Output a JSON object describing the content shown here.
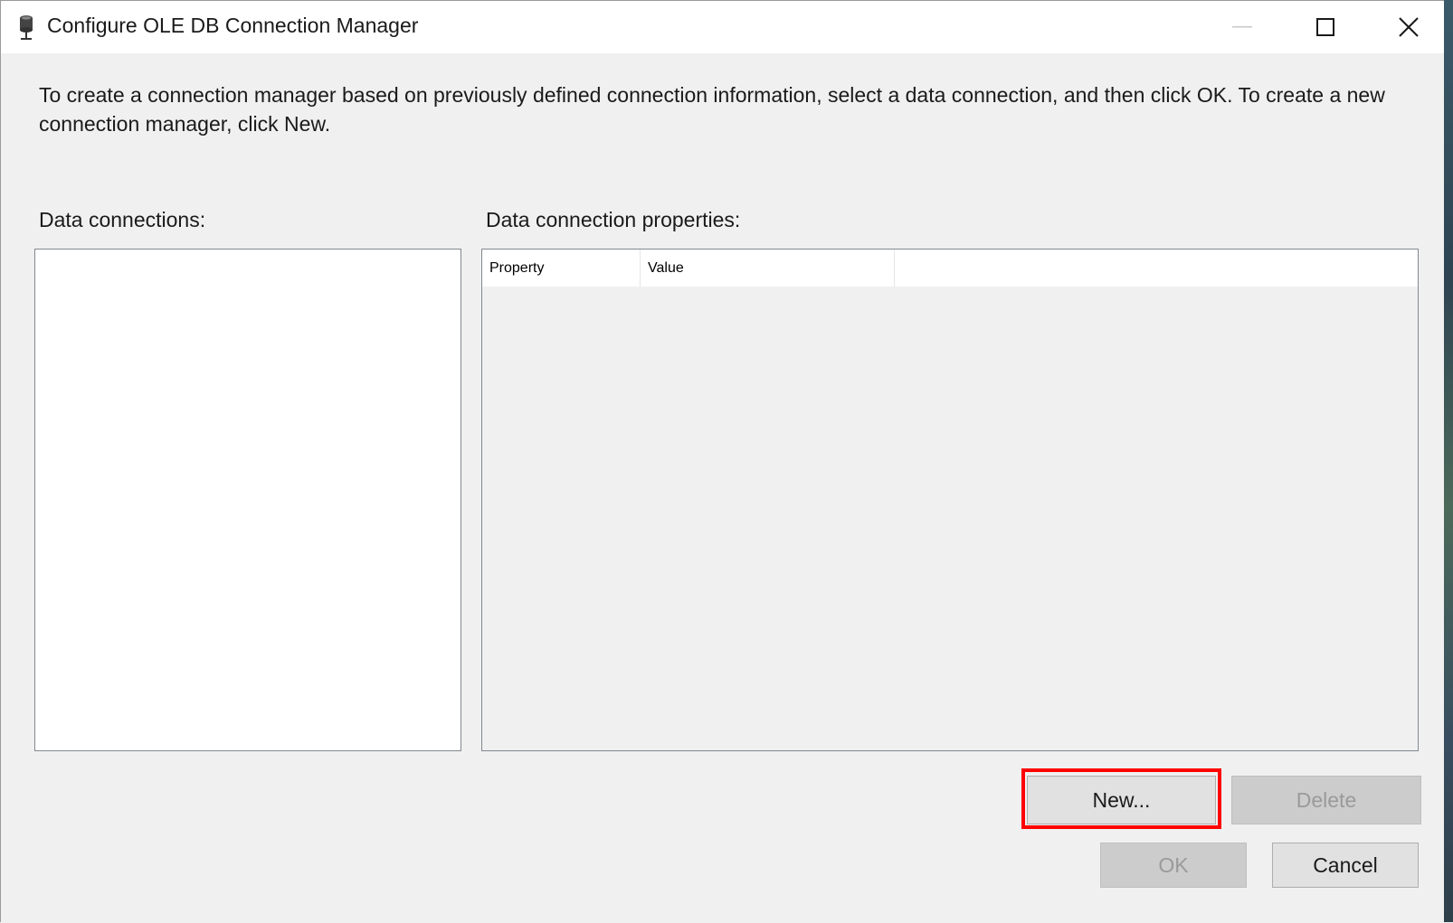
{
  "window": {
    "title": "Configure OLE DB Connection Manager",
    "controls": {
      "minimize_icon": "minimize-icon",
      "maximize_icon": "maximize-icon",
      "close_icon": "close-icon"
    },
    "app_icon": "database-connection-icon"
  },
  "instructions": "To create a connection manager based on previously defined connection information, select a data connection, and then click OK. To create a new connection manager, click New.",
  "data_connections": {
    "label": "Data connections:",
    "items": []
  },
  "properties": {
    "label": "Data connection properties:",
    "columns": [
      "Property",
      "Value"
    ],
    "rows": []
  },
  "buttons": {
    "new": "New...",
    "delete": "Delete",
    "ok": "OK",
    "cancel": "Cancel"
  },
  "highlight": {
    "target": "new",
    "color": "#ff0000"
  }
}
